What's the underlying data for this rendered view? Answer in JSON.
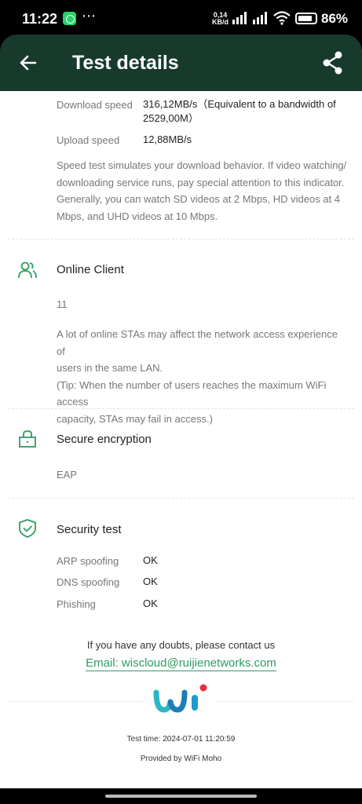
{
  "status_bar": {
    "time": "11:22",
    "overflow": "⋯",
    "net_speed_value": "0,14",
    "net_speed_unit": "KB/d",
    "battery": "86%",
    "battery_level": 0.86,
    "icons": [
      "whatsapp-icon",
      "signal-icon",
      "signal-icon",
      "wifi-icon",
      "battery-icon"
    ]
  },
  "header": {
    "title": "Test details",
    "back_icon": "arrow-left-icon",
    "share_icon": "share-icon",
    "color": "#173a2c"
  },
  "speed": {
    "download_label": "Download speed",
    "download_value_line1": "316,12MB/s（Equivalent to a bandwidth of",
    "download_value_line2": "2529,00M）",
    "upload_label": "Upload speed",
    "upload_value": "12,88MB/s",
    "desc_lines": [
      "Speed test simulates your download behavior. If video watching/",
      "downloading service runs, pay special attention to this indicator.",
      "Generally, you can watch SD videos at 2 Mbps, HD videos at 4",
      "Mbps, and UHD videos at 10 Mbps."
    ]
  },
  "online_client": {
    "title": "Online Client",
    "icon": "users-icon",
    "count": "11",
    "desc_lines": [
      "A lot of online STAs may affect the network access experience of",
      "users in the same LAN.",
      "(Tip: When the number of users reaches the maximum WiFi access",
      "capacity, STAs may fail in access.)"
    ]
  },
  "encryption": {
    "title": "Secure encryption",
    "icon": "lock-icon",
    "value": "EAP"
  },
  "security": {
    "title": "Security test",
    "icon": "shield-check-icon",
    "items": [
      {
        "label": "ARP spoofing",
        "value": "OK"
      },
      {
        "label": "DNS spoofing",
        "value": "OK"
      },
      {
        "label": "Phishing",
        "value": "OK"
      }
    ]
  },
  "footer": {
    "contact_text": "If you have any doubts, please contact us",
    "email_text": "Email: wiscloud@ruijienetworks.com",
    "test_time": "Test time: 2024-07-01 11:20:59",
    "provider": "Provided by WiFi Moho",
    "logo_icon": "wifi-moho-logo-icon",
    "accent": "#2e9d62"
  }
}
